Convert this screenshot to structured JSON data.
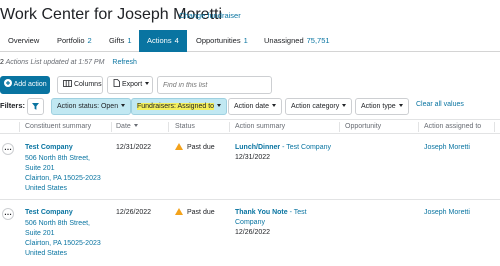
{
  "header": {
    "title": "Work Center for Joseph Moretti",
    "change_link": "Change fundraiser"
  },
  "tabs": [
    {
      "label": "Overview",
      "count": ""
    },
    {
      "label": "Portfolio",
      "count": "2"
    },
    {
      "label": "Gifts",
      "count": "1"
    },
    {
      "label": "Actions",
      "count": "4"
    },
    {
      "label": "Opportunities",
      "count": "1"
    },
    {
      "label": "Unassigned",
      "count": "75,751"
    }
  ],
  "list_status": {
    "count": "2",
    "text": "Actions List updated at 1:57 PM",
    "refresh": "Refresh"
  },
  "toolbar": {
    "add_action": "Add action",
    "columns": "Columns",
    "export": "Export",
    "search_placeholder": "Find in this list"
  },
  "filters": {
    "label": "Filters:",
    "chips": [
      "Action status: Open",
      "Fundraisers: Assigned to",
      "Action date",
      "Action category",
      "Action type"
    ],
    "clear": "Clear all values"
  },
  "table": {
    "headers": [
      "Constituent summary",
      "Date",
      "Status",
      "Action summary",
      "Opportunity",
      "Action assigned to"
    ],
    "rows": [
      {
        "constituent": "Test Company",
        "address": [
          "506 North 8th Street,",
          "Suite 201",
          "Clairton, PA 15025-2023",
          "United States"
        ],
        "date": "12/31/2022",
        "status": "Past due",
        "summary_title": "Lunch/Dinner",
        "summary_sep": " - ",
        "summary_company": "Test Company",
        "summary_date": "12/31/2022",
        "opportunity": "",
        "assigned_to": "Joseph Moretti"
      },
      {
        "constituent": "Test Company",
        "address": [
          "506 North 8th Street,",
          "Suite 201",
          "Clairton, PA 15025-2023",
          "United States"
        ],
        "date": "12/26/2022",
        "status": "Past due",
        "summary_title": "Thank You Note",
        "summary_sep": " - ",
        "summary_company": "Test",
        "summary_company_2": "Company",
        "summary_date": "12/26/2022",
        "opportunity": "",
        "assigned_to": "Joseph Moretti"
      }
    ]
  },
  "colors": {
    "accent": "#0974a1",
    "highlight": "#f4f05c",
    "chip_active": "#c1e8f2",
    "warning": "#f3a21b"
  }
}
